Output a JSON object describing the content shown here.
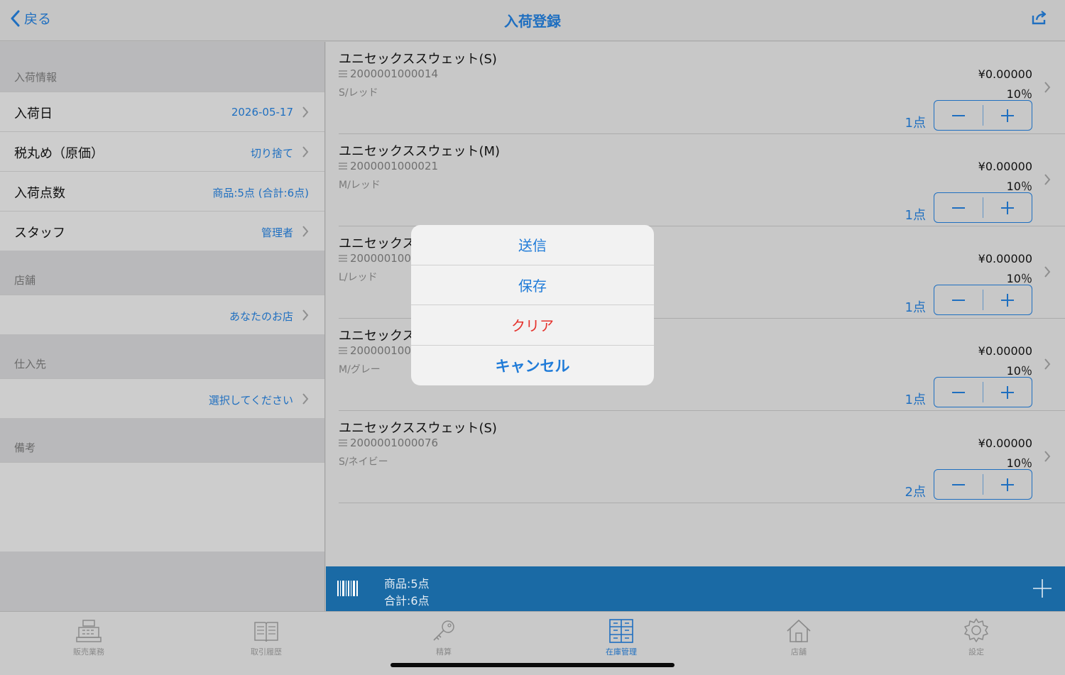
{
  "nav": {
    "back_label": "戻る",
    "title": "入荷登録"
  },
  "left": {
    "section_arrival_info": "入荷情報",
    "arrival_date_label": "入荷日",
    "arrival_date_value": "2026-05-17",
    "rounding_label": "税丸め（原価）",
    "rounding_value": "切り捨て",
    "count_label": "入荷点数",
    "count_value": "商品:5点 (合計:6点)",
    "staff_label": "スタッフ",
    "staff_value": "管理者",
    "section_store": "店舗",
    "store_value": "あなたのお店",
    "section_supplier": "仕入先",
    "supplier_value": "選択してください",
    "section_notes": "備考"
  },
  "items": [
    {
      "name": "ユニセックススウェット(S)",
      "code": "2000001000014",
      "variant": "S/レッド",
      "price": "¥0.00000",
      "tax": "10％",
      "qty": "1点"
    },
    {
      "name": "ユニセックススウェット(M)",
      "code": "2000001000021",
      "variant": "M/レッド",
      "price": "¥0.00000",
      "tax": "10％",
      "qty": "1点"
    },
    {
      "name": "ユニセックス",
      "code": "2000001000",
      "variant": "L/レッド",
      "price": "¥0.00000",
      "tax": "10％",
      "qty": "1点"
    },
    {
      "name": "ユニセックス",
      "code": "2000001000",
      "variant": "M/グレー",
      "price": "¥0.00000",
      "tax": "10％",
      "qty": "1点"
    },
    {
      "name": "ユニセックススウェット(S)",
      "code": "2000001000076",
      "variant": "S/ネイビー",
      "price": "¥0.00000",
      "tax": "10％",
      "qty": "2点"
    }
  ],
  "summary": {
    "products": "商品:5点",
    "total": "合計:6点"
  },
  "action_sheet": {
    "send": "送信",
    "save": "保存",
    "clear": "クリア",
    "cancel": "キャンセル"
  },
  "tabs": [
    {
      "label": "販売業務",
      "icon": "register-icon"
    },
    {
      "label": "取引履歴",
      "icon": "book-icon"
    },
    {
      "label": "精算",
      "icon": "key-icon"
    },
    {
      "label": "在庫管理",
      "icon": "inventory-icon",
      "active": true
    },
    {
      "label": "店舗",
      "icon": "house-icon"
    },
    {
      "label": "設定",
      "icon": "gear-icon"
    }
  ],
  "colors": {
    "accent": "#1f6fc0",
    "summary_bar": "#1a6aa5",
    "destructive": "#e5322c"
  }
}
